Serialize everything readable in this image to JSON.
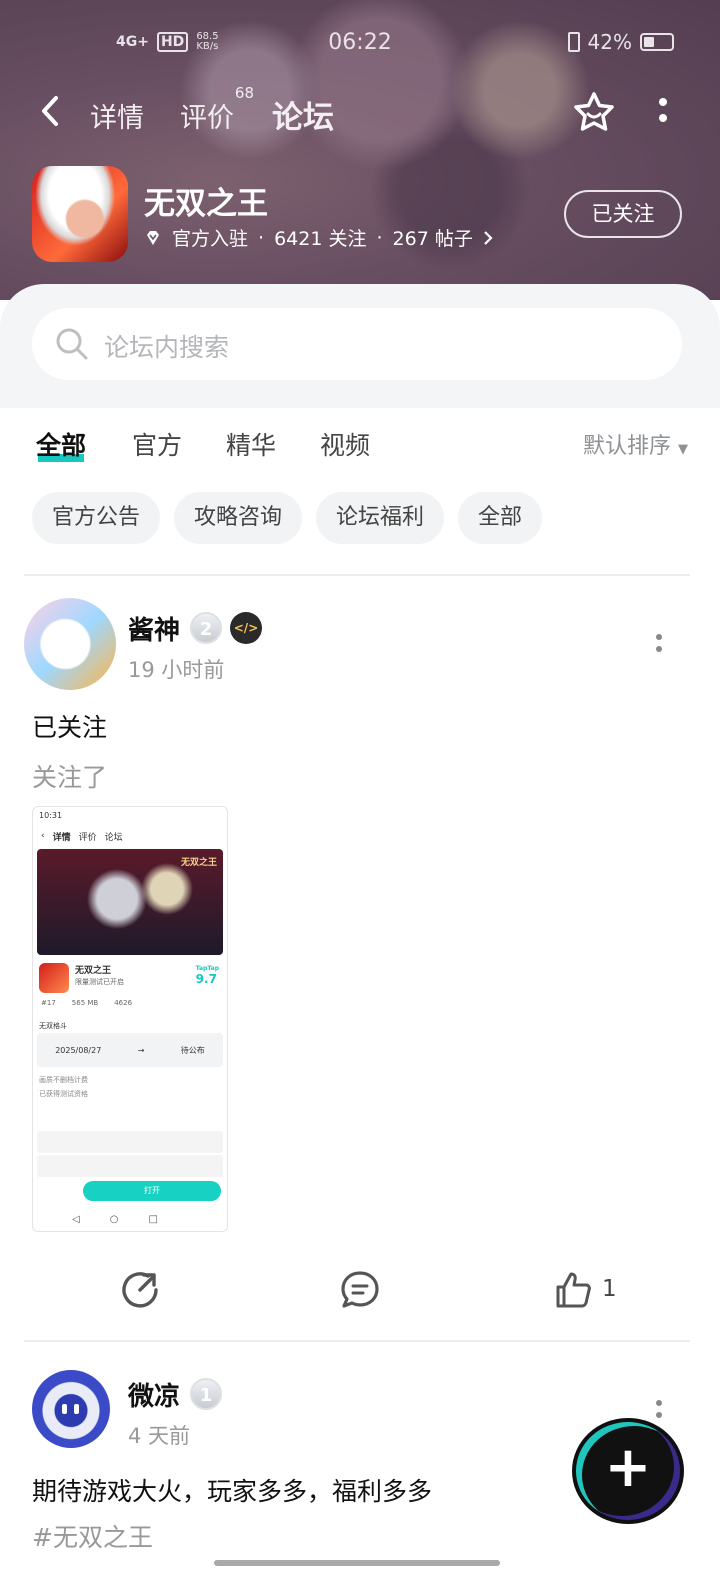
{
  "status_bar": {
    "network": "4G+",
    "hd": "HD",
    "speed": "68.5 KB/s",
    "time": "06:22",
    "battery": "42%"
  },
  "nav": {
    "tabs": [
      {
        "label": "详情"
      },
      {
        "label": "评价",
        "count": "68"
      },
      {
        "label": "论坛"
      }
    ],
    "active_tab": "论坛"
  },
  "app": {
    "name": "无双之王",
    "verified": "官方入驻",
    "followers": "6421 关注",
    "posts": "267 帖子",
    "follow_label": "已关注"
  },
  "search": {
    "placeholder": "论坛内搜索"
  },
  "filters": {
    "tabs": [
      "全部",
      "官方",
      "精华",
      "视频"
    ],
    "active": "全部",
    "sort": "默认排序"
  },
  "chips": [
    "官方公告",
    "攻略咨询",
    "论坛福利",
    "全部"
  ],
  "posts": [
    {
      "user": "酱神",
      "level": "2",
      "time": "19 小时前",
      "title": "已关注",
      "body": "关注了",
      "screenshot": {
        "time": "10:31",
        "tabs": [
          "详情",
          "评价",
          "论坛"
        ],
        "game": "无双之王",
        "subtitle": "限量测试已开启",
        "score": "9.7",
        "score_label": "TapTap",
        "stats": [
          "#17",
          "565 MB",
          "4626"
        ],
        "test_date": "2025/08/27",
        "test_status": "待公布",
        "tag": "无双格斗",
        "lines": [
          "画质不删档计费",
          "已获得测试资格"
        ],
        "open": "打开"
      },
      "likes": "1"
    },
    {
      "user": "微凉",
      "level": "1",
      "time": "4 天前",
      "title": "期待游戏大火，玩家多多，福利多多",
      "tag": "#无双之王"
    }
  ],
  "colors": {
    "accent": "#17c8c0",
    "hero": "#6e5564"
  }
}
